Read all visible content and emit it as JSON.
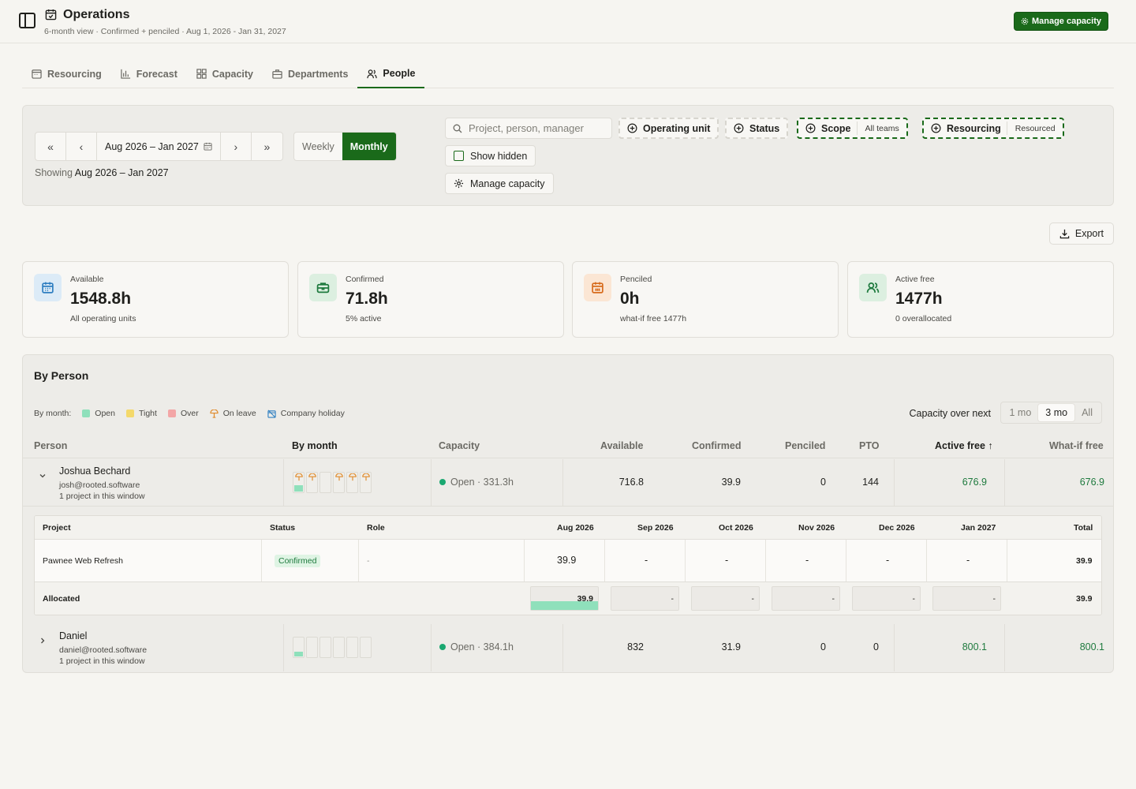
{
  "header": {
    "title": "Operations",
    "subtitle": "6-month view · Confirmed + penciled · Aug 1, 2026 - Jan 31, 2027",
    "primary_button": "Manage capacity"
  },
  "tabs": [
    {
      "label": "Resourcing",
      "icon": "calendar-icon",
      "active": false
    },
    {
      "label": "Forecast",
      "icon": "bar-chart-icon",
      "active": false
    },
    {
      "label": "Capacity",
      "icon": "grid-icon",
      "active": false
    },
    {
      "label": "Departments",
      "icon": "briefcase-icon",
      "active": false
    },
    {
      "label": "People",
      "icon": "users-icon",
      "active": true
    }
  ],
  "filters": {
    "date_range": "Aug 2026 – Jan 2027",
    "view_options": [
      "Weekly",
      "Monthly"
    ],
    "view_selected": "Monthly",
    "showing_prefix": "Showing",
    "showing_range": "Aug 2026 – Jan 2027",
    "search_placeholder": "Project, person, manager",
    "chips": [
      {
        "label": "Operating unit",
        "value": ""
      },
      {
        "label": "Status",
        "value": ""
      },
      {
        "label": "Scope",
        "value": "All teams"
      },
      {
        "label": "Resourcing",
        "value": "Resourced"
      }
    ],
    "show_hidden": "Show hidden",
    "manage_capacity": "Manage capacity"
  },
  "export_label": "Export",
  "stats": [
    {
      "label": "Available",
      "value": "1548.8h",
      "sub": "All operating units",
      "color": "#2f7fc1",
      "bg": "#dcebf7"
    },
    {
      "label": "Confirmed",
      "value": "71.8h",
      "sub": "5% active",
      "color": "#1e7a3e",
      "bg": "#dcefe0"
    },
    {
      "label": "Penciled",
      "value": "0h",
      "sub": "what-if free 1477h",
      "color": "#d76b1d",
      "bg": "#fbe6d4"
    },
    {
      "label": "Active free",
      "value": "1477h",
      "sub": "0 overallocated",
      "color": "#1e7a3e",
      "bg": "#dcefe0"
    }
  ],
  "by_person": {
    "title": "By Person",
    "legend_prefix": "By month:",
    "legend": [
      {
        "label": "Open",
        "color": "#8fe0bb"
      },
      {
        "label": "Tight",
        "color": "#f4d96b"
      },
      {
        "label": "Over",
        "color": "#f3a6a6"
      },
      {
        "label": "On leave",
        "color": "#e08a2a"
      },
      {
        "label": "Company holiday",
        "color": "#2f7fc1"
      }
    ],
    "capacity_label": "Capacity over next",
    "capacity_options": [
      "1 mo",
      "3 mo",
      "All"
    ],
    "capacity_selected": "3 mo",
    "columns": {
      "person": "Person",
      "by_month": "By month",
      "capacity": "Capacity",
      "available": "Available",
      "confirmed": "Confirmed",
      "penciled": "Penciled",
      "pto": "PTO",
      "active_free": "Active free",
      "whatif_free": "What-if free"
    },
    "people": [
      {
        "name": "Joshua Bechard",
        "email": "josh@rooted.software",
        "projects": "1 project in this window",
        "capacity": "Open · 331.3h",
        "available": "716.8",
        "confirmed": "39.9",
        "penciled": "0",
        "pto": "144",
        "active_free": "676.9",
        "whatif_free": "676.9"
      },
      {
        "name": "Daniel",
        "email": "daniel@rooted.software",
        "projects": "1 project in this window",
        "capacity": "Open · 384.1h",
        "available": "832",
        "confirmed": "31.9",
        "penciled": "0",
        "pto": "0",
        "active_free": "800.1",
        "whatif_free": "800.1"
      }
    ],
    "project_table": {
      "headers": {
        "project": "Project",
        "status": "Status",
        "role": "Role",
        "months": [
          "Aug 2026",
          "Sep 2026",
          "Oct 2026",
          "Nov 2026",
          "Dec 2026",
          "Jan 2027"
        ],
        "total": "Total"
      },
      "row": {
        "project": "Pawnee Web Refresh",
        "status": "Confirmed",
        "role": "-",
        "months": [
          "39.9",
          "-",
          "-",
          "-",
          "-",
          "-"
        ],
        "total": "39.9"
      },
      "allocated": {
        "label": "Allocated",
        "months": [
          "39.9",
          "-",
          "-",
          "-",
          "-",
          "-"
        ],
        "total": "39.9"
      }
    }
  }
}
